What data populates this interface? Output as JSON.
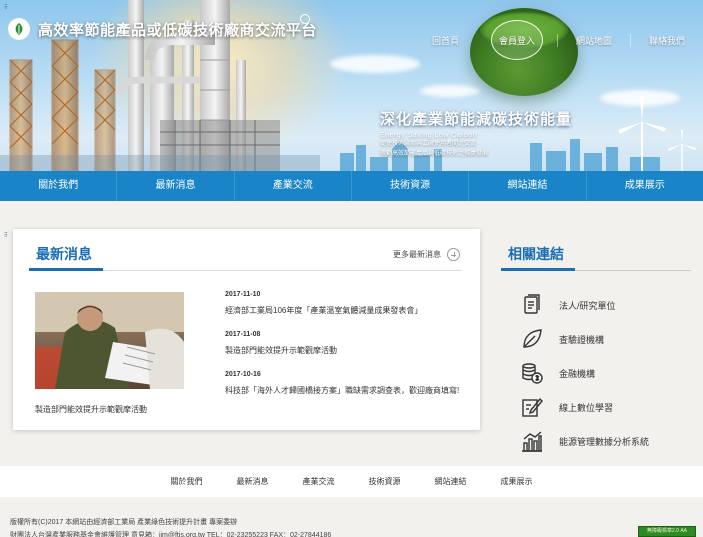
{
  "header": {
    "site_title": "高效率節能產品或低碳技術廠商交流平台",
    "top_links": [
      "回首頁",
      "會員登入",
      "網站地圖",
      "聯絡我們"
    ],
    "slogan_title": "深化產業節能減碳技術能量",
    "slogan_en": "Energy Saving   Low Carbon",
    "slogan_lines": [
      "促使技術廠商與工廠使用者間之交流",
      "帶動高效節能產品與低碳技術之推廣發展"
    ]
  },
  "nav": {
    "items": [
      "關於我們",
      "最新消息",
      "產業交流",
      "技術資源",
      "網站連結",
      "成果展示"
    ]
  },
  "news": {
    "title": "最新消息",
    "more_label": "更多最新消息",
    "feature_caption": "製造部門能效提升示範觀摩活動",
    "items": [
      {
        "date": "2017-11-10",
        "text": "經濟部工業局106年度「產業溫室氣體減量成果發表會」"
      },
      {
        "date": "2017-11-08",
        "text": "製造部門能效提升示範觀摩活動"
      },
      {
        "date": "2017-10-16",
        "text": "科技部「海外人才歸國橋接方案」職缺需求調查表，歡迎廠商填寫!"
      }
    ]
  },
  "related": {
    "title": "相關連結",
    "items": [
      {
        "label": "法人/研究單位",
        "icon": "document-stack-icon"
      },
      {
        "label": "查驗證機構",
        "icon": "leaf-icon"
      },
      {
        "label": "金融機構",
        "icon": "coins-icon"
      },
      {
        "label": "線上數位學習",
        "icon": "edit-icon"
      },
      {
        "label": "能源管理數據分析系統",
        "icon": "factory-chart-icon"
      }
    ]
  },
  "footer": {
    "links": [
      "關於我們",
      "最新消息",
      "產業交流",
      "技術資源",
      "網站連結",
      "成果展示"
    ],
    "copyright_1": "版權所有(C)2017 本網站由經濟部工業局 產業綠色技術提升計畫 專案委辦",
    "copyright_2": "財團法人台灣產業服務基金會維護管理 意見箱：jim@ftis.org.tw TEL：02-23255223 FAX：02-27844186",
    "badge": "無障礙標章2.0 AA"
  },
  "colors": {
    "nav_blue": "#1a84c8",
    "heading_blue": "#1a6eb5",
    "badge_green": "#2e8a24"
  }
}
